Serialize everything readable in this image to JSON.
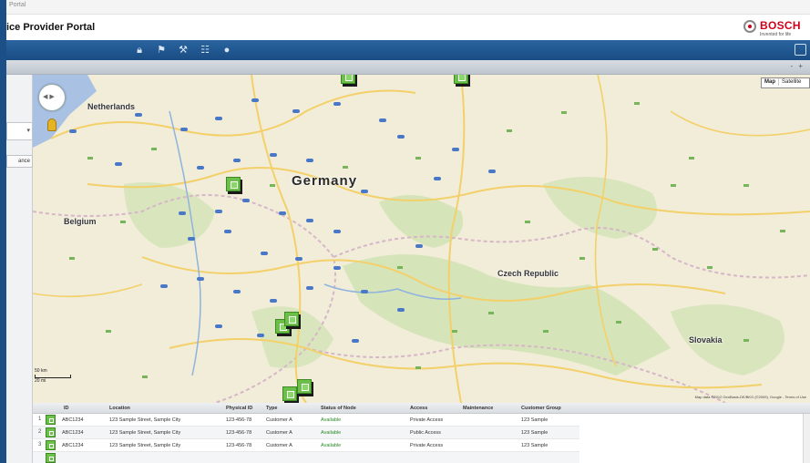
{
  "window": {
    "crumb": "Portal"
  },
  "header": {
    "title": "ice Provider Portal"
  },
  "logo": {
    "brand": "BOSCH",
    "tagline": "Invented for life"
  },
  "toolbar": {
    "icons": [
      "lock-icon",
      "bookmark-icon",
      "tools-icon",
      "document-icon",
      "info-icon"
    ]
  },
  "subbar": {
    "zoom_controls": "- +"
  },
  "map": {
    "map_type": {
      "map": "Map",
      "satellite": "Satellite"
    },
    "countries": {
      "germany": "Germany",
      "netherlands": "Netherlands",
      "belgium": "Belgium",
      "czech": "Czech Republic",
      "slovakia": "Slovakia"
    },
    "scale": {
      "km": "50 km",
      "mi": "20 mi"
    },
    "credits": "Map data ©2012 GeoBasis-DE/BKG (©2009), Google - Terms of Use"
  },
  "grid": {
    "columns": [
      "ID",
      "Location",
      "Physical ID",
      "Type",
      "Status of Node",
      "Access",
      "Maintenance",
      "Customer Group"
    ],
    "rows": [
      {
        "n": "1",
        "id": "ABC1234",
        "location": "123 Sample Street, Sample City",
        "physical": "123-456-78",
        "type": "Customer A",
        "status": "Available",
        "access": "Private Access",
        "customer": "123 Sample"
      },
      {
        "n": "2",
        "id": "ABC1234",
        "location": "123 Sample Street, Sample City",
        "physical": "123-456-78",
        "type": "Customer A",
        "status": "Available",
        "access": "Public Access",
        "customer": "123 Sample"
      },
      {
        "n": "3",
        "id": "ABC1234",
        "location": "123 Sample Street, Sample City",
        "physical": "123-456-78",
        "type": "Customer A",
        "status": "Available",
        "access": "Private Access",
        "customer": "123 Sample"
      }
    ]
  },
  "colors": {
    "brand_red": "#d0021b",
    "toolbar_blue": "#1f5690",
    "marker_green": "#6cc04a"
  }
}
